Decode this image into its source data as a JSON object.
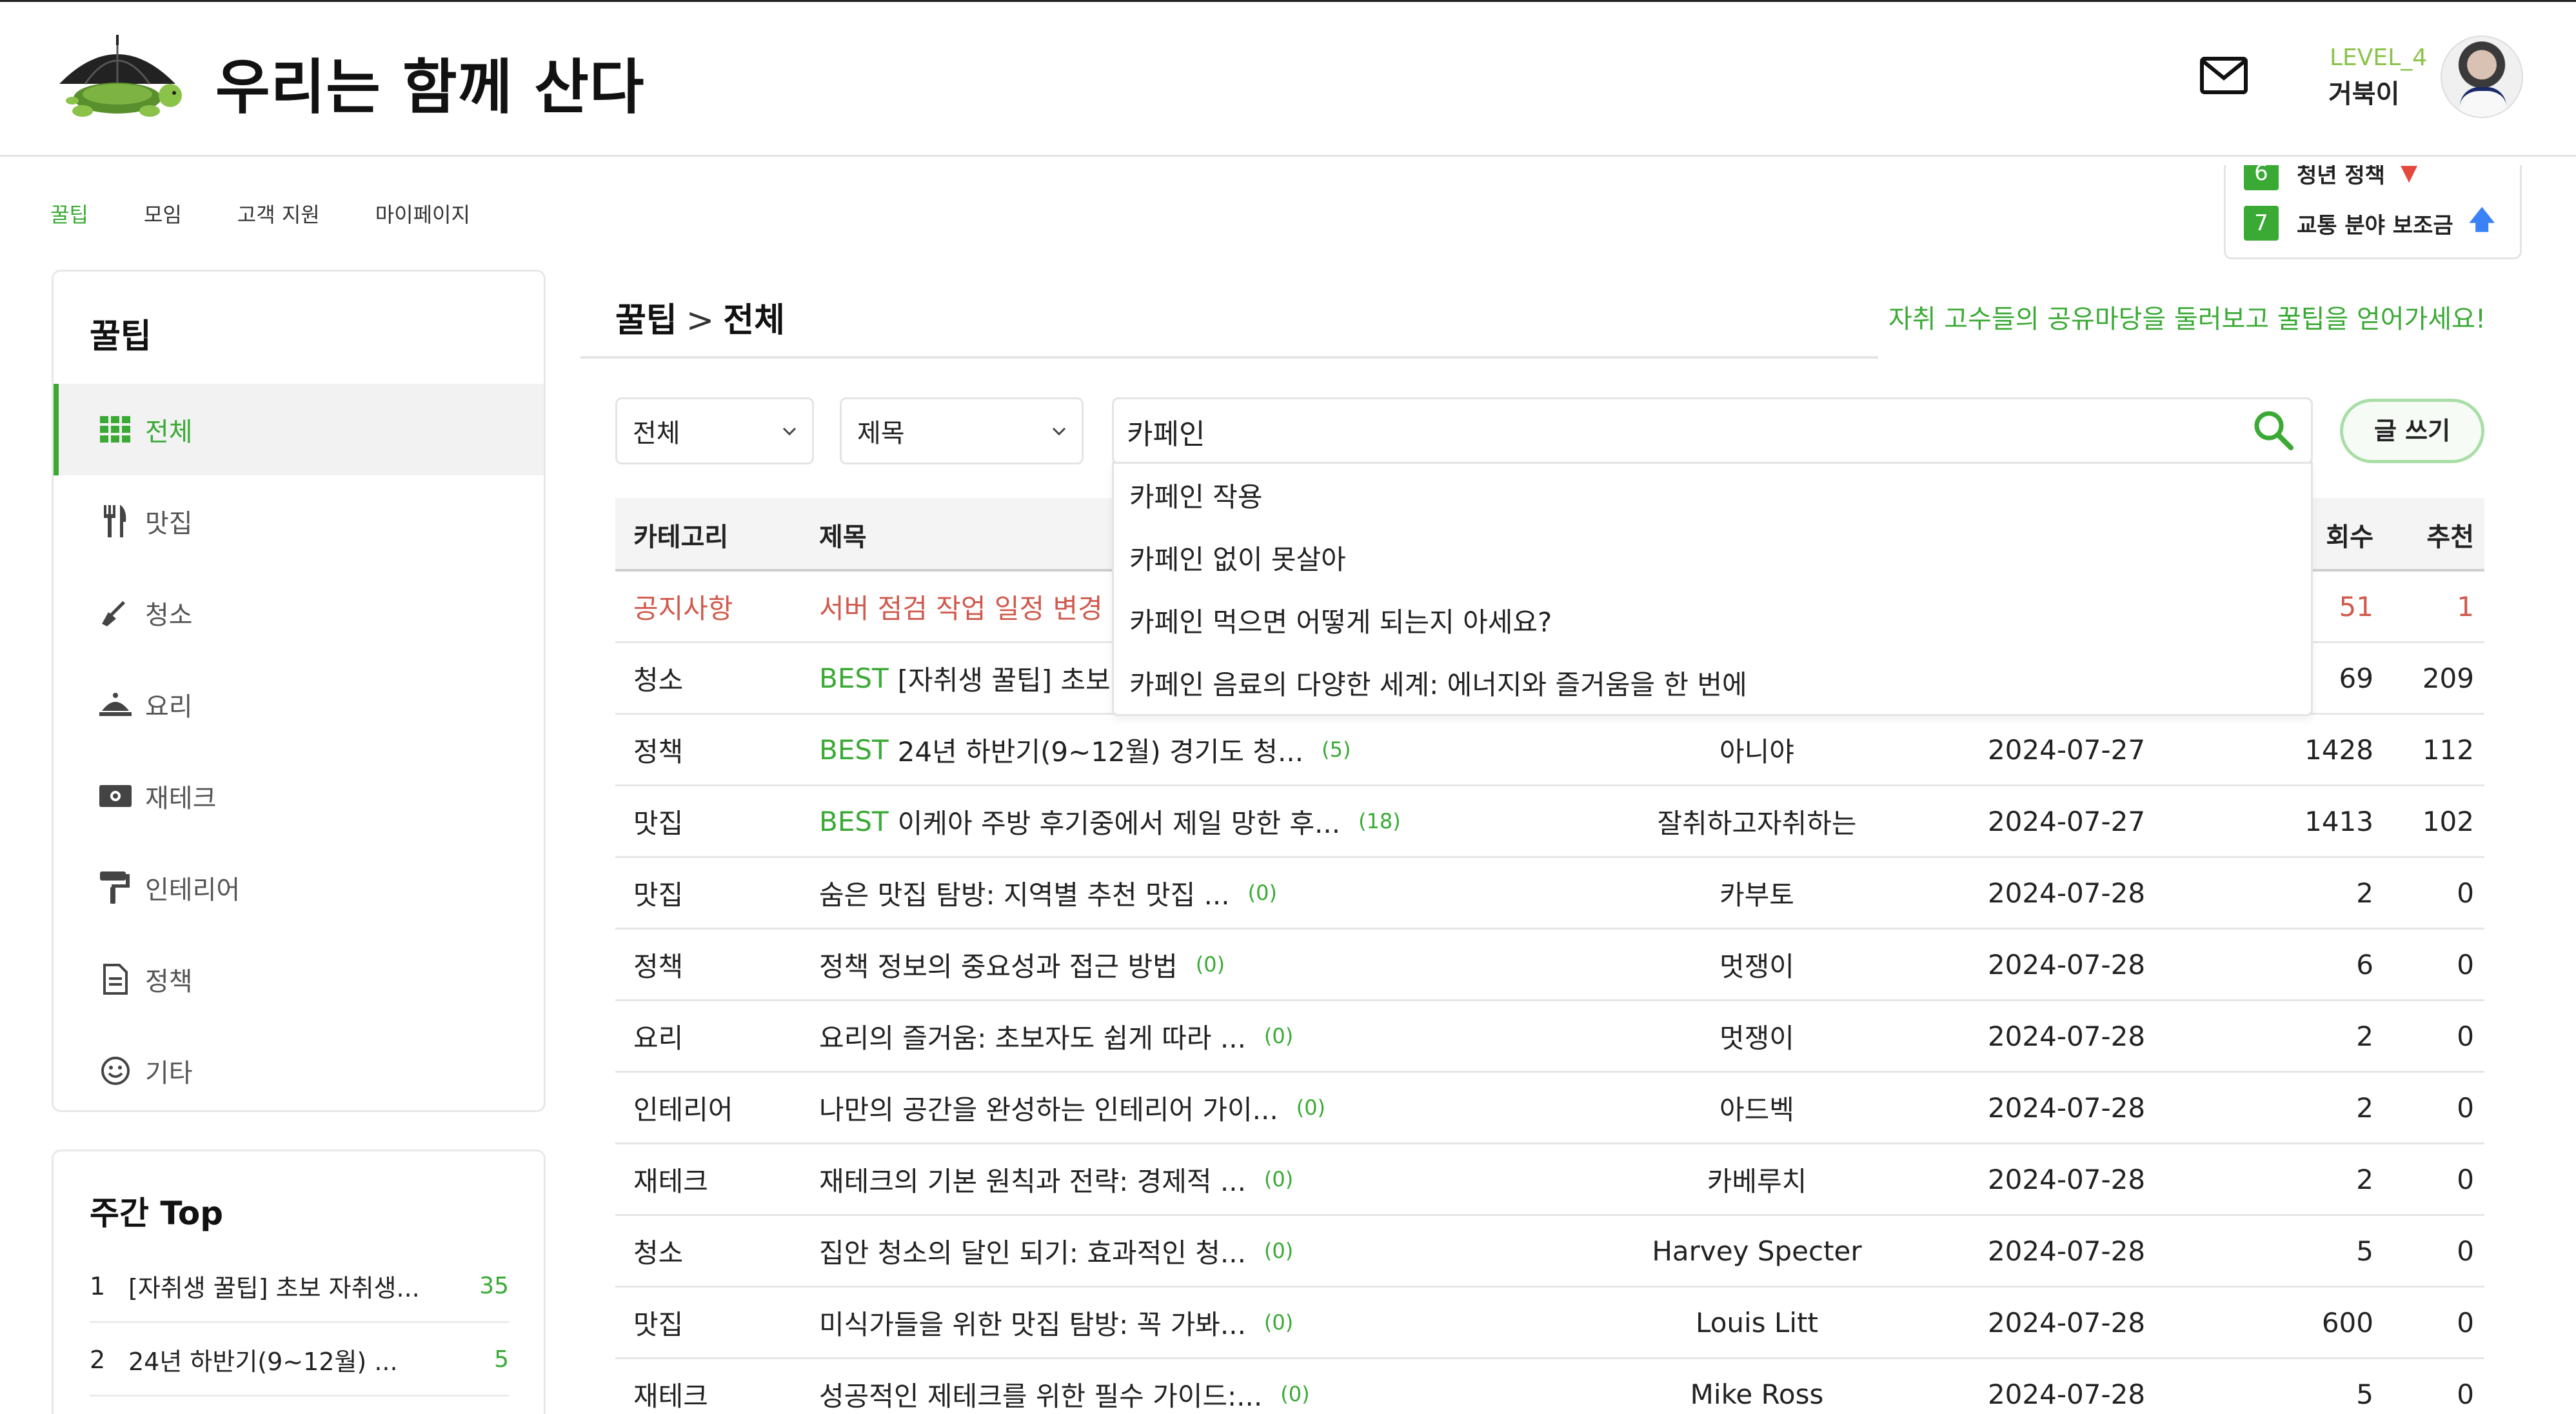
{
  "header": {
    "site_title": "우리는 함께 산다",
    "level": "LEVEL_4",
    "username": "거북이"
  },
  "nav": [
    "꿀팁",
    "모임",
    "고객 지원",
    "마이페이지"
  ],
  "ticker": [
    {
      "rank": "6",
      "text": "청년 정책",
      "trend": "down"
    },
    {
      "rank": "7",
      "text": "교통 분야 보조금",
      "trend": "up"
    }
  ],
  "sidebar": {
    "title": "꿀팁",
    "items": [
      {
        "label": "전체",
        "icon": "grid-icon"
      },
      {
        "label": "맛집",
        "icon": "utensils-icon"
      },
      {
        "label": "청소",
        "icon": "broom-icon"
      },
      {
        "label": "요리",
        "icon": "cloche-icon"
      },
      {
        "label": "재테크",
        "icon": "money-icon"
      },
      {
        "label": "인테리어",
        "icon": "paint-roller-icon"
      },
      {
        "label": "정책",
        "icon": "document-icon"
      },
      {
        "label": "기타",
        "icon": "smile-icon"
      }
    ]
  },
  "weekly_top": {
    "title": "주간 Top",
    "items": [
      {
        "rank": "1",
        "title": "[자취생 꿀팁] 초보 자취생...",
        "count": "35"
      },
      {
        "rank": "2",
        "title": "24년 하반기(9~12월) ...",
        "count": "5"
      }
    ]
  },
  "main": {
    "breadcrumb_root": "꿀팁",
    "breadcrumb_sep": ">",
    "breadcrumb_current": "전체",
    "tagline": "자취 고수들의 공유마당을 둘러보고 꿀팁을 얻어가세요!",
    "category_select": "전체",
    "field_select": "제목",
    "search_value": "카페인",
    "write_button": "글 쓰기"
  },
  "suggestions": [
    "카페인 작용",
    "카페인 없이 못살아",
    "카페인 먹으면 어떻게 되는지 아세요?",
    "카페인 음료의 다양한 세계: 에너지와 즐거움을 한 번에"
  ],
  "table": {
    "headers": {
      "category": "카테고리",
      "title": "제목",
      "views_partial": "회수",
      "recommend": "추천"
    },
    "rows": [
      {
        "category": "공지사항",
        "best": "",
        "title": "서버 점검 작업 일정 변경 안",
        "comments": "",
        "author": "",
        "date": "",
        "views": "51",
        "rec": "1",
        "notice": true
      },
      {
        "category": "청소",
        "best": "BEST",
        "title": "[자취생 꿀팁] 초보 자",
        "comments": "",
        "author": "",
        "date": "",
        "views": "69",
        "rec": "209"
      },
      {
        "category": "정책",
        "best": "BEST",
        "title": "24년 하반기(9~12월) 경기도 청...",
        "comments": "(5)",
        "author": "아니야",
        "date": "2024-07-27",
        "views": "1428",
        "rec": "112"
      },
      {
        "category": "맛집",
        "best": "BEST",
        "title": "이케아 주방 후기중에서 제일 망한 후...",
        "comments": "(18)",
        "author": "잘취하고자취하는",
        "date": "2024-07-27",
        "views": "1413",
        "rec": "102"
      },
      {
        "category": "맛집",
        "best": "",
        "title": "숨은 맛집 탐방: 지역별 추천 맛집 ...",
        "comments": "(0)",
        "author": "카부토",
        "date": "2024-07-28",
        "views": "2",
        "rec": "0"
      },
      {
        "category": "정책",
        "best": "",
        "title": "정책 정보의 중요성과 접근 방법",
        "comments": "(0)",
        "author": "멋쟁이",
        "date": "2024-07-28",
        "views": "6",
        "rec": "0"
      },
      {
        "category": "요리",
        "best": "",
        "title": "요리의 즐거움: 초보자도 쉽게 따라 ...",
        "comments": "(0)",
        "author": "멋쟁이",
        "date": "2024-07-28",
        "views": "2",
        "rec": "0"
      },
      {
        "category": "인테리어",
        "best": "",
        "title": "나만의 공간을 완성하는 인테리어 가이...",
        "comments": "(0)",
        "author": "아드벡",
        "date": "2024-07-28",
        "views": "2",
        "rec": "0"
      },
      {
        "category": "재테크",
        "best": "",
        "title": "재테크의 기본 원칙과 전략: 경제적 ...",
        "comments": "(0)",
        "author": "카베루치",
        "date": "2024-07-28",
        "views": "2",
        "rec": "0"
      },
      {
        "category": "청소",
        "best": "",
        "title": "집안 청소의 달인 되기: 효과적인 청...",
        "comments": "(0)",
        "author": "Harvey Specter",
        "date": "2024-07-28",
        "views": "5",
        "rec": "0"
      },
      {
        "category": "맛집",
        "best": "",
        "title": "미식가들을 위한 맛집 탐방: 꼭 가봐...",
        "comments": "(0)",
        "author": "Louis Litt",
        "date": "2024-07-28",
        "views": "600",
        "rec": "0"
      },
      {
        "category": "재테크",
        "best": "",
        "title": "성공적인 제테크를 위한 필수 가이드:...",
        "comments": "(0)",
        "author": "Mike Ross",
        "date": "2024-07-28",
        "views": "5",
        "rec": "0"
      }
    ]
  },
  "colors": {
    "accent": "#3aaa35",
    "notice": "#d05a4d",
    "link_up": "#3b82f6"
  }
}
